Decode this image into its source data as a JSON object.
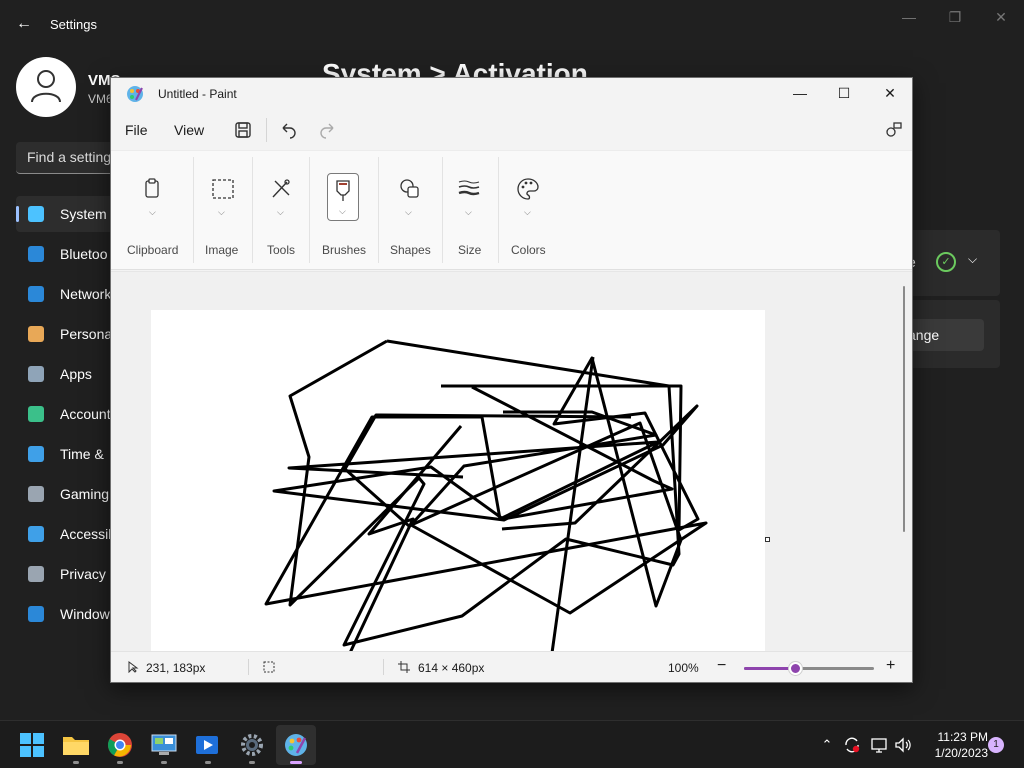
{
  "settings": {
    "title": "Settings",
    "user_name": "VMS",
    "user_sub": "VM6",
    "heading": "System  >  Activation",
    "search_placeholder": "Find a setting",
    "nav": [
      {
        "label": "System",
        "icon": "monitor-icon",
        "selected": true
      },
      {
        "label": "Bluetoo",
        "icon": "bluetooth-icon"
      },
      {
        "label": "Network",
        "icon": "wifi-icon"
      },
      {
        "label": "Persona",
        "icon": "brush-icon"
      },
      {
        "label": "Apps",
        "icon": "apps-icon"
      },
      {
        "label": "Account",
        "icon": "person-icon"
      },
      {
        "label": "Time &",
        "icon": "clock-icon"
      },
      {
        "label": "Gaming",
        "icon": "gamepad-icon"
      },
      {
        "label": "Accessib",
        "icon": "accessibility-icon"
      },
      {
        "label": "Privacy &",
        "icon": "shield-icon"
      },
      {
        "label": "Window",
        "icon": "windows-update-icon"
      }
    ],
    "card_text": "e",
    "change_button": "ange"
  },
  "paint": {
    "title": "Untitled - Paint",
    "menu": {
      "file": "File",
      "view": "View"
    },
    "ribbon": {
      "clipboard": "Clipboard",
      "image": "Image",
      "tools": "Tools",
      "brushes": "Brushes",
      "shapes": "Shapes",
      "size": "Size",
      "colors": "Colors"
    },
    "status": {
      "cursor_pos": "231, 183px",
      "canvas_size": "614 × 460px",
      "zoom": "100%",
      "zoom_value": 0.39
    }
  },
  "taskbar": {
    "apps": [
      "start-icon",
      "file-explorer-icon",
      "chrome-icon",
      "control-panel-icon",
      "media-player-icon",
      "settings-gear-icon",
      "paint-icon"
    ],
    "time": "11:23 PM",
    "date": "1/20/2023",
    "notification_count": "1"
  }
}
